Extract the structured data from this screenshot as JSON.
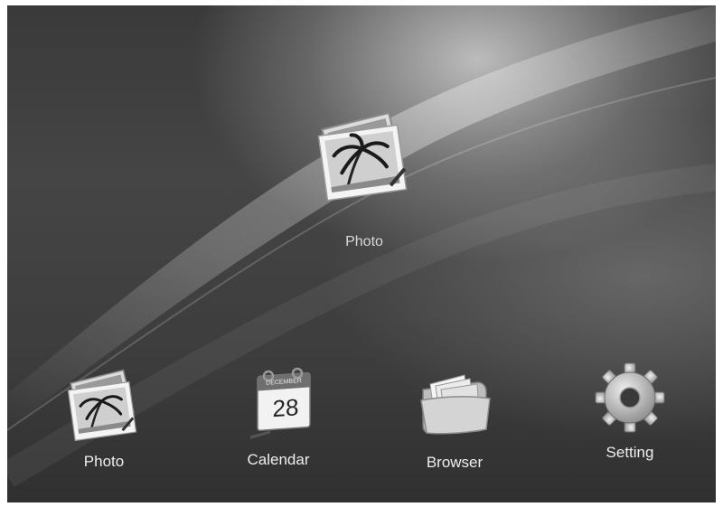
{
  "featured": {
    "label": "Photo",
    "icon": "photo-stack-icon"
  },
  "dock": [
    {
      "label": "Photo",
      "icon": "photo-stack-icon"
    },
    {
      "label": "Calendar",
      "icon": "calendar-icon",
      "month": "DECEMBER",
      "day": "28"
    },
    {
      "label": "Browser",
      "icon": "folder-files-icon"
    },
    {
      "label": "Setting",
      "icon": "gear-icon"
    }
  ]
}
